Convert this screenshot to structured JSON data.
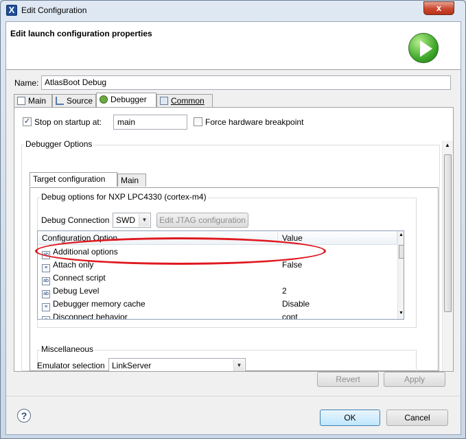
{
  "window": {
    "title": "Edit Configuration",
    "close_glyph": "x"
  },
  "header": {
    "title": "Edit launch configuration properties",
    "icon": "run-icon"
  },
  "name": {
    "label": "Name:",
    "value": "AtlasBoot Debug"
  },
  "tabs": [
    {
      "label": "Main",
      "icon": "main-tab-icon"
    },
    {
      "label": "Source",
      "icon": "source-tab-icon"
    },
    {
      "label": "Debugger",
      "icon": "debugger-tab-icon",
      "active": true
    },
    {
      "label": "Common",
      "icon": "common-tab-icon"
    }
  ],
  "debugger": {
    "stop_on_startup_label": "Stop on startup at:",
    "stop_on_startup_checked": true,
    "stop_on_startup_value": "main",
    "force_hw_bp_label": "Force hardware breakpoint",
    "force_hw_bp_checked": false,
    "options_label": "Debugger Options",
    "inner_tabs": [
      {
        "label": "Target configuration",
        "active": true
      },
      {
        "label": "Main"
      }
    ],
    "debug_options_label": "Debug options for NXP LPC4330 (cortex-m4)",
    "connection_label": "Debug Connection",
    "connection_value": "SWD",
    "edit_jtag_label": "Edit JTAG configuration",
    "table": {
      "columns": [
        "Configuration Option",
        "Value"
      ],
      "rows": [
        {
          "option": "Additional options",
          "value": "",
          "icon": "text-option-icon"
        },
        {
          "option": "Attach only",
          "value": "False",
          "icon": "list-option-icon"
        },
        {
          "option": "Connect script",
          "value": "",
          "icon": "text-option-icon"
        },
        {
          "option": "Debug Level",
          "value": "2",
          "icon": "text-option-icon"
        },
        {
          "option": "Debugger memory cache",
          "value": "Disable",
          "icon": "list-option-icon"
        },
        {
          "option": "Disconnect behavior",
          "value": "cont",
          "icon": "list-option-icon"
        }
      ]
    },
    "misc_label": "Miscellaneous",
    "emulator_label": "Emulator selection",
    "emulator_value": "LinkServer"
  },
  "buttons": {
    "revert": "Revert",
    "apply": "Apply",
    "ok": "OK",
    "cancel": "Cancel",
    "help_glyph": "?"
  },
  "colors": {
    "highlight_ellipse": "#e01820",
    "ok_border": "#3c7fb1"
  }
}
